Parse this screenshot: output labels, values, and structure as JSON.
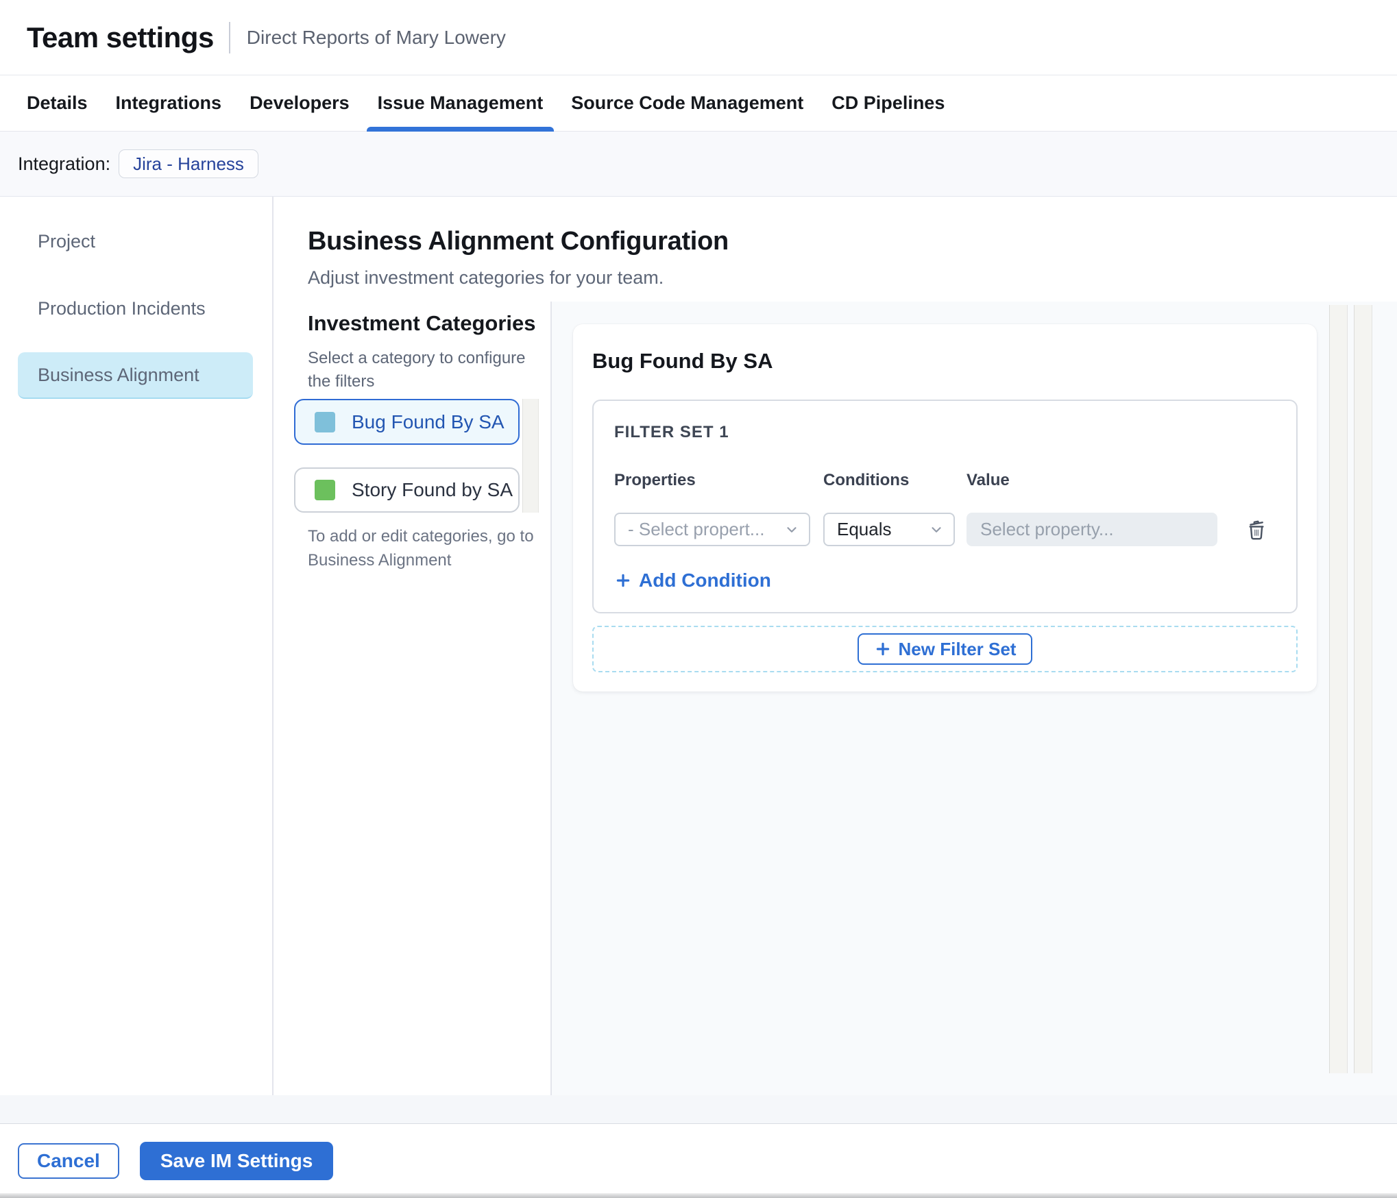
{
  "header": {
    "title": "Team settings",
    "subtitle": "Direct Reports of Mary Lowery"
  },
  "tabs": {
    "items": [
      {
        "label": "Details"
      },
      {
        "label": "Integrations"
      },
      {
        "label": "Developers"
      },
      {
        "label": "Issue Management"
      },
      {
        "label": "Source Code Management"
      },
      {
        "label": "CD Pipelines"
      }
    ],
    "active": "Issue Management"
  },
  "integration_bar": {
    "label": "Integration:",
    "chip": "Jira - Harness"
  },
  "sidebar": {
    "items": [
      {
        "label": "Project"
      },
      {
        "label": "Production Incidents"
      },
      {
        "label": "Business Alignment"
      }
    ],
    "selected": "Business Alignment"
  },
  "main": {
    "title": "Business Alignment Configuration",
    "subtitle": "Adjust investment categories for your team.",
    "categories": {
      "heading": "Investment Categories",
      "helper": "Select a category to configure the filters",
      "items": [
        {
          "label": "Bug Found By SA",
          "swatch_color": "#7fc0da",
          "selected": true
        },
        {
          "label": "Story Found by SA",
          "swatch_color": "#6cc05d",
          "selected": false
        }
      ],
      "note": "To add or edit categories, go to Business Alignment"
    },
    "panel": {
      "title": "Bug Found By SA",
      "filter_set": {
        "title": "FILTER SET 1",
        "columns": [
          "Properties",
          "Conditions",
          "Value"
        ],
        "property_placeholder": "- Select propert...",
        "condition_value": "Equals",
        "value_placeholder": "Select property...",
        "add_condition_label": "Add Condition"
      },
      "new_filter_set_label": "New Filter Set"
    }
  },
  "footer": {
    "cancel_label": "Cancel",
    "save_label": "Save IM Settings"
  },
  "colors": {
    "accent_blue": "#2e6fd4",
    "active_tab_underline": "#3273d8",
    "sidebar_highlight": "#cdecf8",
    "selected_category_bg": "#eef8fd",
    "bug_swatch": "#7fc0da",
    "story_swatch": "#6cc05d",
    "chip_text": "#26439b",
    "dashed_border": "#a9dcf0",
    "value_input_bg": "#e9edf1"
  }
}
